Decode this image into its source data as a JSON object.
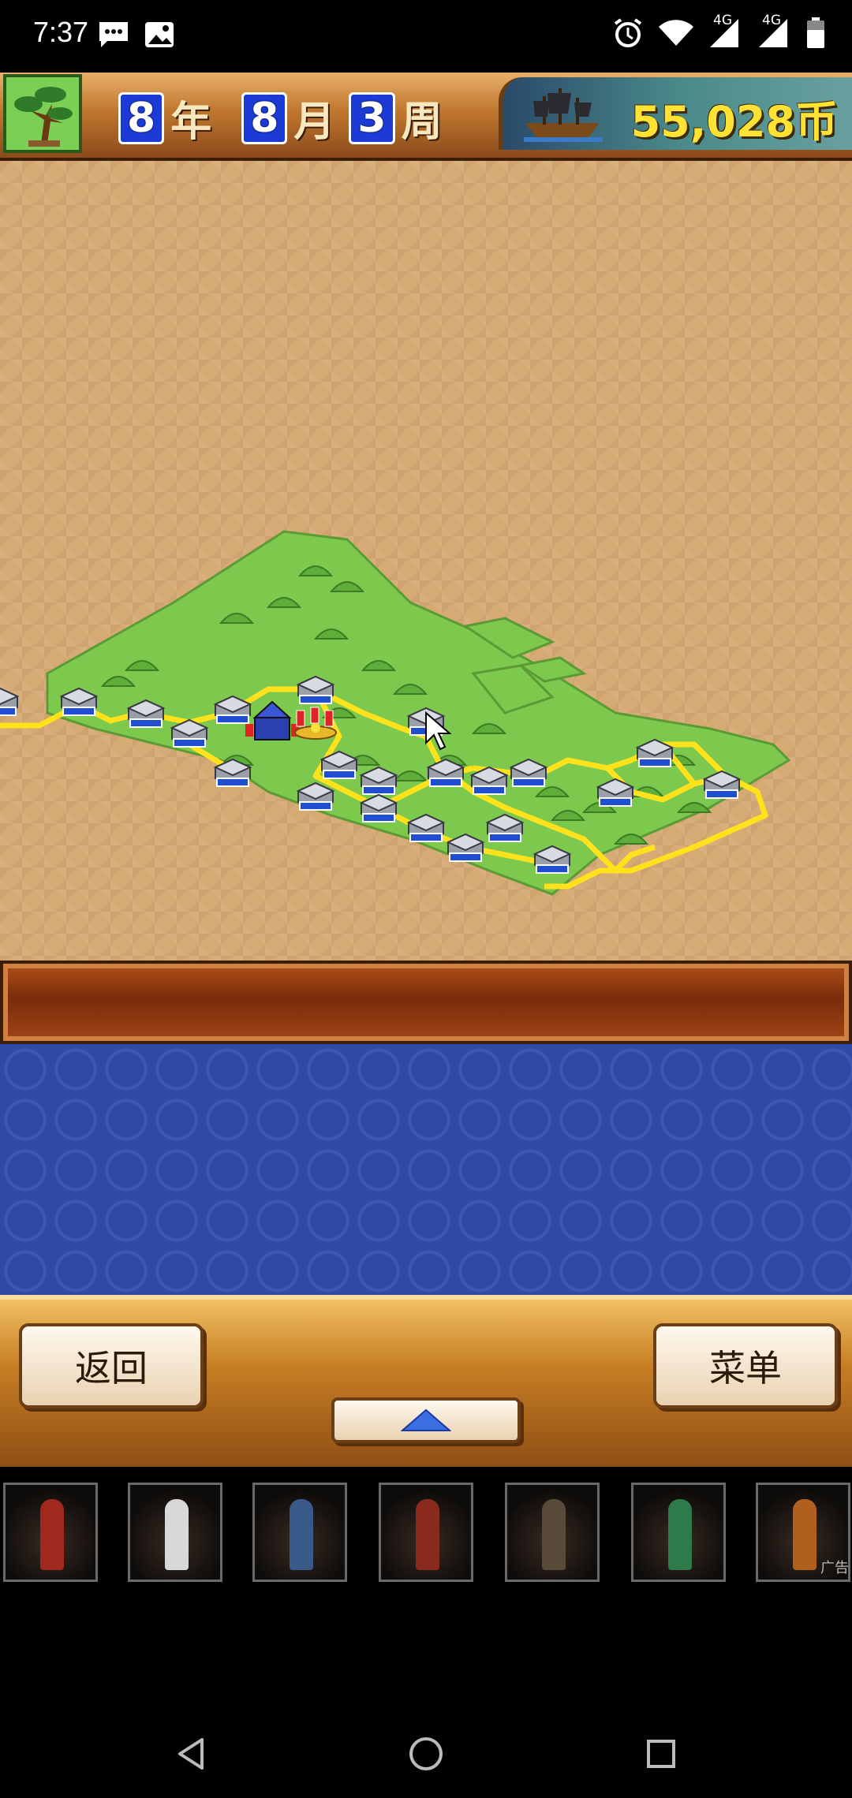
{
  "status_bar": {
    "time": "7:37",
    "network_1": "4G",
    "network_2": "4G"
  },
  "header": {
    "year_num": "8",
    "year_unit": "年",
    "month_num": "8",
    "month_unit": "月",
    "week_num": "3",
    "week_unit": "周",
    "coins": "55,028币"
  },
  "controls": {
    "back_label": "返回",
    "menu_label": "菜单"
  },
  "ad": {
    "label": "广告",
    "cards": [
      "warrior-red",
      "knight-white",
      "mage-blue",
      "warlord-red",
      "swordsman-dark",
      "sorceress-green",
      "berserker-orange"
    ]
  },
  "colors": {
    "desert": "#d6aa74",
    "grass": "#7cc94e",
    "road": "#ffe21c",
    "panel_blue": "#2f4aa6"
  }
}
